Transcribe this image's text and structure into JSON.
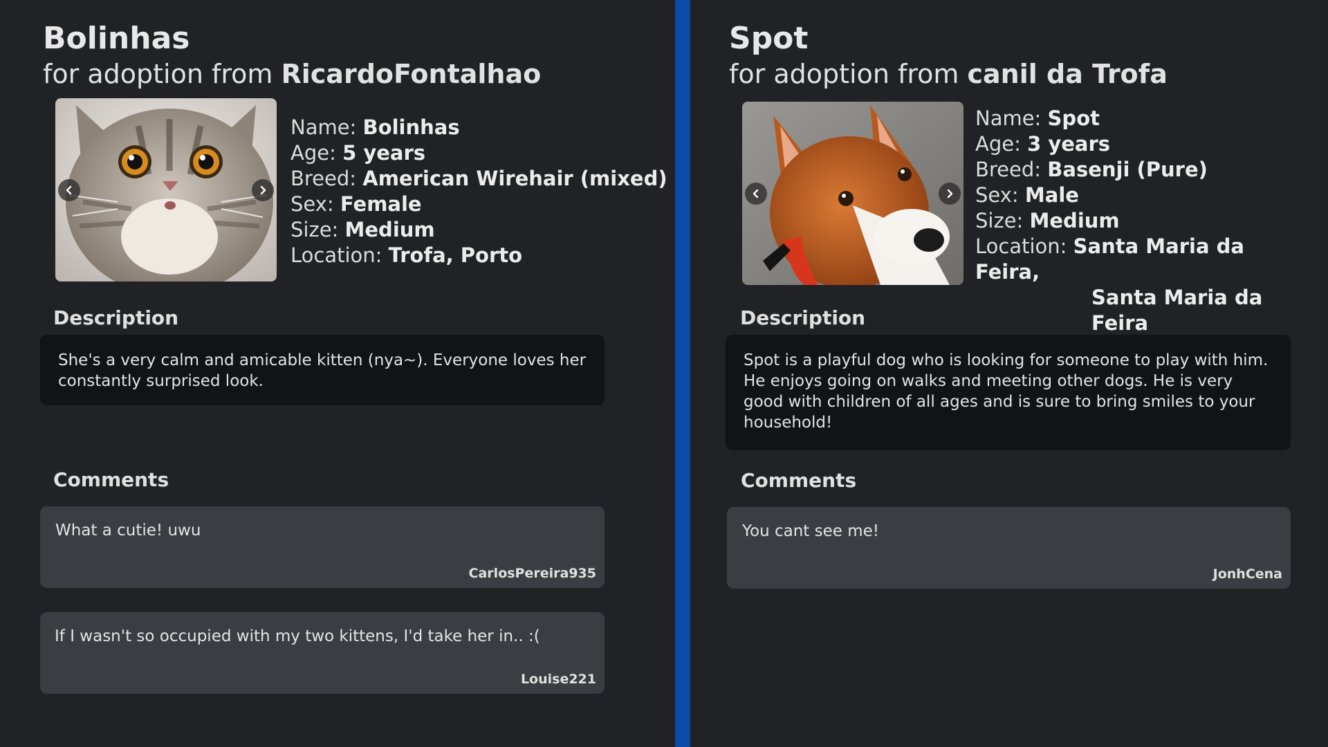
{
  "pets": [
    {
      "title": "Bolinhas",
      "subtitle_prefix": "for adoption from ",
      "owner": "RicardoFontalhao",
      "photo_icon": "cat-photo",
      "details": {
        "name_label": "Name: ",
        "name": "Bolinhas",
        "age_label": "Age: ",
        "age": "5 years",
        "breed_label": "Breed: ",
        "breed": "American Wirehair (mixed)",
        "sex_label": "Sex: ",
        "sex": "Female",
        "size_label": "Size: ",
        "size": "Medium",
        "location_label": "Location: ",
        "location": "Trofa, Porto"
      },
      "description_title": "Description",
      "description": "She's a very calm and amicable kitten (nya~). Everyone loves her constantly surprised look.",
      "comments_title": "Comments",
      "comments": [
        {
          "text": "What a cutie! uwu",
          "author": "CarlosPereira935"
        },
        {
          "text": "If I wasn't so occupied with my two kittens, I'd take her in.. :(",
          "author": "Louise221"
        }
      ]
    },
    {
      "title": "Spot",
      "subtitle_prefix": "for adoption from ",
      "owner": "canil da Trofa",
      "photo_icon": "dog-photo",
      "details": {
        "name_label": "Name: ",
        "name": "Spot",
        "age_label": "Age: ",
        "age": "3 years",
        "breed_label": "Breed: ",
        "breed": "Basenji (Pure)",
        "sex_label": "Sex: ",
        "sex": "Male",
        "size_label": "Size: ",
        "size": "Medium",
        "location_label": "Location: ",
        "location_line1": "Santa Maria da Feira,",
        "location_line2": "Santa Maria da Feira"
      },
      "description_title": "Description",
      "description": "Spot is a playful dog who is looking for someone to play with him. He enjoys going on walks and meeting other dogs. He is very good with children of all ages and is sure to bring smiles to your household!",
      "comments_title": "Comments",
      "comments": [
        {
          "text": "You cant see me!",
          "author": "JonhCena"
        }
      ]
    }
  ],
  "colors": {
    "background": "#212226",
    "divider": "#0b4aa8",
    "description_bg": "#121315",
    "comment_bg": "#3b3d42"
  }
}
